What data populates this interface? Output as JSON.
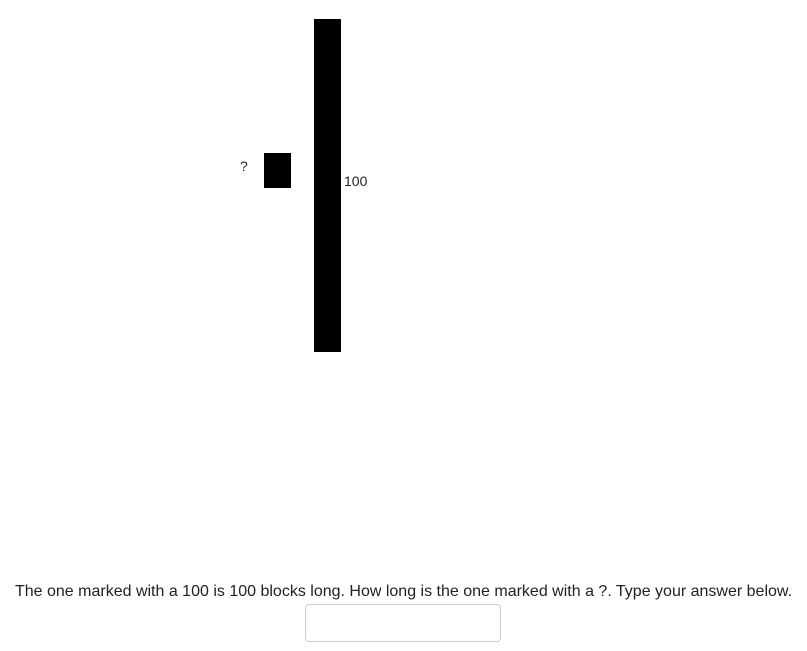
{
  "chart_data": {
    "type": "bar",
    "categories": [
      "?",
      "100"
    ],
    "values": [
      null,
      100
    ],
    "reference_value": 100
  },
  "bars": {
    "small_label": "?",
    "large_label": "100"
  },
  "question": {
    "text": "The one marked with a 100 is 100 blocks long. How long is the one marked with a ?. Type your answer below."
  },
  "answer": {
    "value": "",
    "placeholder": ""
  }
}
